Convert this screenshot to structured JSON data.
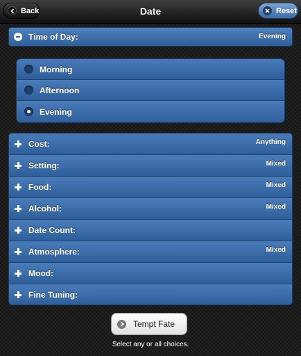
{
  "header": {
    "title": "Date",
    "back_label": "Back",
    "reset_label": "Reset"
  },
  "time_of_day": {
    "label": "Time of Day:",
    "value": "Evening",
    "expanded": true,
    "options": [
      {
        "label": "Morning",
        "checked": false
      },
      {
        "label": "Afternoon",
        "checked": false
      },
      {
        "label": "Evening",
        "checked": true
      }
    ]
  },
  "choices": [
    {
      "label": "Cost:",
      "value": "Anything"
    },
    {
      "label": "Setting:",
      "value": "Mixed"
    },
    {
      "label": "Food:",
      "value": "Mixed"
    },
    {
      "label": "Alcohol:",
      "value": "Mixed"
    },
    {
      "label": "Date Count:",
      "value": ""
    },
    {
      "label": "Atmosphere:",
      "value": "Mixed"
    },
    {
      "label": "Mood:",
      "value": ""
    },
    {
      "label": "Fine Tuning:",
      "value": ""
    }
  ],
  "tempt_button": {
    "label": "Tempt Fate"
  },
  "hint": "Select any or all choices.",
  "colors": {
    "accent": "#2f5f9a",
    "header": "#1f1f1f",
    "background": "#1c1c1c"
  }
}
